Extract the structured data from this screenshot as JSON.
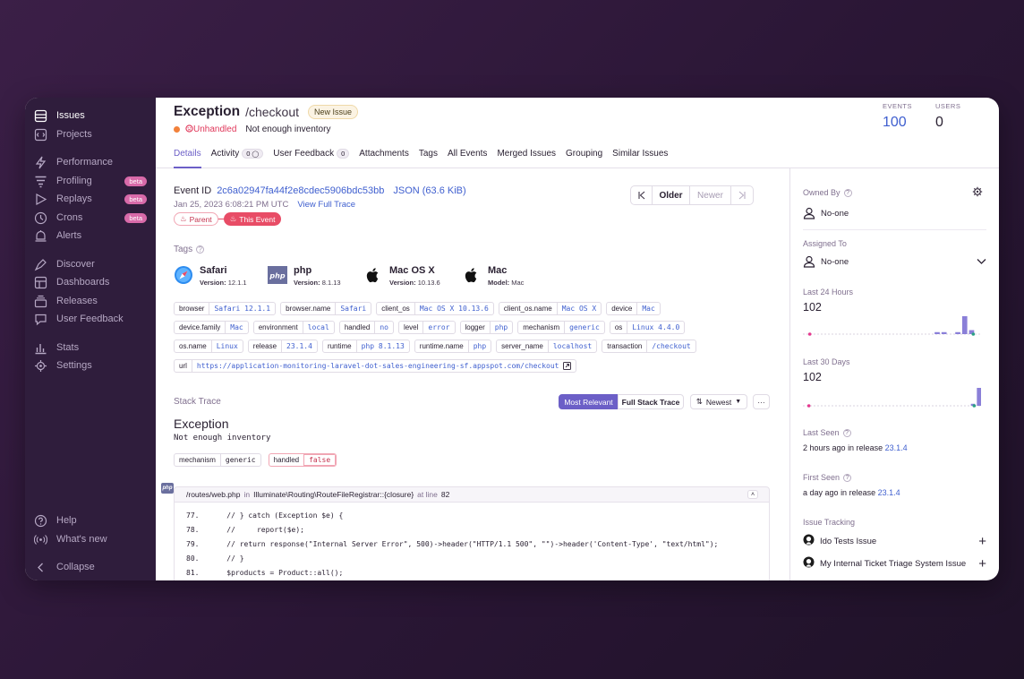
{
  "sidebar": {
    "items": [
      {
        "label": "Issues",
        "icon": "issues-icon"
      },
      {
        "label": "Projects",
        "icon": "projects-icon"
      },
      {
        "label": "Performance",
        "icon": "performance-icon"
      },
      {
        "label": "Profiling",
        "icon": "profiling-icon",
        "badge": "beta"
      },
      {
        "label": "Replays",
        "icon": "replays-icon",
        "badge": "beta"
      },
      {
        "label": "Crons",
        "icon": "crons-icon",
        "badge": "beta"
      },
      {
        "label": "Alerts",
        "icon": "alerts-icon"
      },
      {
        "label": "Discover",
        "icon": "discover-icon"
      },
      {
        "label": "Dashboards",
        "icon": "dashboards-icon"
      },
      {
        "label": "Releases",
        "icon": "releases-icon"
      },
      {
        "label": "User Feedback",
        "icon": "feedback-icon"
      },
      {
        "label": "Stats",
        "icon": "stats-icon"
      },
      {
        "label": "Settings",
        "icon": "settings-icon"
      }
    ],
    "footer": [
      {
        "label": "Help",
        "icon": "help-icon"
      },
      {
        "label": "What's new",
        "icon": "broadcast-icon"
      },
      {
        "label": "Collapse",
        "icon": "collapse-icon"
      }
    ]
  },
  "header": {
    "title": "Exception",
    "subtitle": "/checkout",
    "new_issue": "New Issue",
    "unhandled": "Unhandled",
    "message": "Not enough inventory",
    "events_label": "EVENTS",
    "events_value": "100",
    "users_label": "USERS",
    "users_value": "0",
    "tabs": [
      {
        "label": "Details"
      },
      {
        "label": "Activity",
        "count": "0"
      },
      {
        "label": "User Feedback",
        "count": "0"
      },
      {
        "label": "Attachments"
      },
      {
        "label": "Tags"
      },
      {
        "label": "All Events"
      },
      {
        "label": "Merged Issues"
      },
      {
        "label": "Grouping"
      },
      {
        "label": "Similar Issues"
      }
    ]
  },
  "event": {
    "id_label": "Event ID",
    "id": "2c6a02947fa44f2e8cdec5906bdc53bb",
    "json": "JSON (63.6 KiB)",
    "date": "Jan 25, 2023 6:08:21 PM UTC",
    "view_trace": "View Full Trace",
    "parent": "Parent",
    "this_event": "This Event",
    "older": "Older",
    "newer": "Newer"
  },
  "tags": {
    "heading": "Tags",
    "cards": [
      {
        "name": "Safari",
        "version_label": "Version:",
        "version": "12.1.1",
        "icon": "safari-icon"
      },
      {
        "name": "php",
        "version_label": "Version:",
        "version": "8.1.13",
        "icon": "php-icon"
      },
      {
        "name": "Mac OS X",
        "version_label": "Version:",
        "version": "10.13.6",
        "icon": "apple-icon"
      },
      {
        "name": "Mac",
        "version_label": "Model:",
        "version": "Mac",
        "icon": "apple-icon"
      }
    ],
    "rows": [
      [
        {
          "k": "browser",
          "v": "Safari 12.1.1"
        },
        {
          "k": "browser.name",
          "v": "Safari"
        },
        {
          "k": "client_os",
          "v": "Mac OS X 10.13.6"
        },
        {
          "k": "client_os.name",
          "v": "Mac OS X"
        },
        {
          "k": "device",
          "v": "Mac"
        }
      ],
      [
        {
          "k": "device.family",
          "v": "Mac"
        },
        {
          "k": "environment",
          "v": "local"
        },
        {
          "k": "handled",
          "v": "no"
        },
        {
          "k": "level",
          "v": "error"
        },
        {
          "k": "logger",
          "v": "php"
        },
        {
          "k": "mechanism",
          "v": "generic"
        },
        {
          "k": "os",
          "v": "Linux 4.4.0"
        }
      ],
      [
        {
          "k": "os.name",
          "v": "Linux"
        },
        {
          "k": "release",
          "v": "23.1.4"
        },
        {
          "k": "runtime",
          "v": "php 8.1.13"
        },
        {
          "k": "runtime.name",
          "v": "php"
        },
        {
          "k": "server_name",
          "v": "localhost"
        },
        {
          "k": "transaction",
          "v": "/checkout"
        }
      ],
      [
        {
          "k": "url",
          "v": "https://application-monitoring-laravel-dot-sales-engineering-sf.appspot.com/checkout"
        }
      ]
    ]
  },
  "stack": {
    "heading": "Stack Trace",
    "most_relevant": "Most Relevant",
    "full_stack": "Full Stack Trace",
    "sort": "Newest",
    "more": "···",
    "exception_title": "Exception",
    "exception_msg": "Not enough inventory",
    "mech_k": "mechanism",
    "mech_v": "generic",
    "handled_k": "handled",
    "handled_v": "false",
    "frame_file": "/routes/web.php",
    "frame_in": "in",
    "frame_fn": "Illuminate\\Routing\\RouteFileRegistrar::{closure}",
    "frame_at": "at line",
    "frame_line": "82",
    "code": [
      {
        "n": "77.",
        "t": "    // } catch (Exception $e) {"
      },
      {
        "n": "78.",
        "t": "    //     report($e);"
      },
      {
        "n": "79.",
        "t": "    // return response(\"Internal Server Error\", 500)->header(\"HTTP/1.1 500\", \"\")->header('Content-Type', \"text/html\");"
      },
      {
        "n": "80.",
        "t": "    // }"
      },
      {
        "n": "81.",
        "t": "    $products = Product::all();"
      }
    ]
  },
  "side": {
    "owned_by": "Owned By",
    "owner": "No-one",
    "assigned_to": "Assigned To",
    "assignee": "No-one",
    "last24_label": "Last 24 Hours",
    "last24_value": "102",
    "last30_label": "Last 30 Days",
    "last30_value": "102",
    "last_seen_label": "Last Seen",
    "last_seen_time": "2 hours ago",
    "last_seen_in": "in release",
    "last_seen_release": "23.1.4",
    "first_seen_label": "First Seen",
    "first_seen_time": "a day ago",
    "first_seen_in": "in release",
    "first_seen_release": "23.1.4",
    "tracking_label": "Issue Tracking",
    "tracking_items": [
      {
        "label": "Ido Tests Issue"
      },
      {
        "label": "My Internal Ticket Triage System Issue"
      }
    ]
  },
  "spark24": [
    0,
    0,
    0,
    0,
    0,
    0,
    0,
    0,
    0,
    0,
    0,
    0,
    0,
    0,
    0,
    0,
    0,
    0,
    0,
    1,
    1,
    0,
    1,
    9,
    2,
    0
  ],
  "spark30": [
    0,
    0,
    0,
    0,
    0,
    0,
    0,
    0,
    0,
    0,
    0,
    0,
    0,
    0,
    0,
    0,
    0,
    0,
    0,
    0,
    0,
    0,
    0,
    0,
    0,
    0,
    0,
    0,
    1,
    9
  ],
  "colors": {
    "accent": "#6c5fc7",
    "sidebar": "#2f1d3c",
    "error": "#e84c66",
    "link": "#3f5fcf"
  }
}
